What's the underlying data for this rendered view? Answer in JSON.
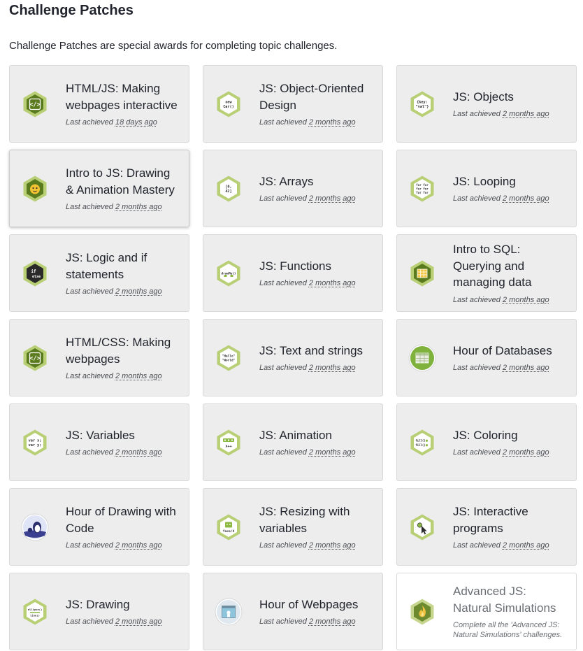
{
  "header": {
    "title": "Challenge Patches",
    "description": "Challenge Patches are special awards for completing topic challenges."
  },
  "colors": {
    "hex_outer": "#b8cf75",
    "hex_inner": "#5a7a1e",
    "card_bg": "#ededed",
    "text": "#21242c"
  },
  "patches": [
    {
      "title": "HTML/JS: Making webpages interactive",
      "achieved_label": "Last achieved",
      "achieved_ago": "18 days ago",
      "icon": "code-brackets-icon"
    },
    {
      "title": "JS: Object-Oriented Design",
      "achieved_label": "Last achieved",
      "achieved_ago": "2 months ago",
      "icon": "new-car-code-icon",
      "glyph_lines": [
        "new",
        "Car()"
      ]
    },
    {
      "title": "JS: Objects",
      "achieved_label": "Last achieved",
      "achieved_ago": "2 months ago",
      "icon": "key-val-object-icon",
      "glyph_lines": [
        "{key:",
        "\"val\"}"
      ]
    },
    {
      "title": "Intro to JS: Drawing & Animation Mastery",
      "achieved_label": "Last achieved",
      "achieved_ago": "2 months ago",
      "icon": "winston-character-icon"
    },
    {
      "title": "JS: Arrays",
      "achieved_label": "Last achieved",
      "achieved_ago": "2 months ago",
      "icon": "array-brackets-icon",
      "glyph_lines": [
        "[0,",
        "42]"
      ]
    },
    {
      "title": "JS: Looping",
      "achieved_label": "Last achieved",
      "achieved_ago": "2 months ago",
      "icon": "for-loop-icon",
      "glyph_lines": [
        "for for",
        "for for",
        "for for"
      ]
    },
    {
      "title": "JS: Logic and if statements",
      "achieved_label": "Last achieved",
      "achieved_ago": "2 months ago",
      "icon": "if-else-icon",
      "glyph_lines": [
        "if",
        "else"
      ]
    },
    {
      "title": "JS: Functions",
      "achieved_label": "Last achieved",
      "achieved_ago": "2 months ago",
      "icon": "function-call-icon",
      "glyph_lines": [
        "drawMe()"
      ]
    },
    {
      "title": "Intro to SQL: Querying and managing data",
      "achieved_label": "Last achieved",
      "achieved_ago": "2 months ago",
      "icon": "database-table-icon"
    },
    {
      "title": "HTML/CSS: Making webpages",
      "achieved_label": "Last achieved",
      "achieved_ago": "2 months ago",
      "icon": "code-brackets-icon"
    },
    {
      "title": "JS: Text and strings",
      "achieved_label": "Last achieved",
      "achieved_ago": "2 months ago",
      "icon": "hello-world-string-icon",
      "glyph_lines": [
        "\"Hello\"",
        "\"World\""
      ]
    },
    {
      "title": "Hour of Databases",
      "achieved_label": "Last achieved",
      "achieved_ago": "2 months ago",
      "icon": "database-circle-icon"
    },
    {
      "title": "JS: Variables",
      "achieved_label": "Last achieved",
      "achieved_ago": "2 months ago",
      "icon": "var-declaration-icon",
      "glyph_lines": [
        "var x;",
        "var y;"
      ]
    },
    {
      "title": "JS: Animation",
      "achieved_label": "Last achieved",
      "achieved_ago": "2 months ago",
      "icon": "animation-frames-icon",
      "glyph_lines": [
        "x++"
      ]
    },
    {
      "title": "JS: Coloring",
      "achieved_label": "Last achieved",
      "achieved_ago": "2 months ago",
      "icon": "fill-color-icon",
      "glyph_lines": [
        "fill()",
        "fill()"
      ]
    },
    {
      "title": "Hour of Drawing with Code",
      "achieved_label": "Last achieved",
      "achieved_ago": "2 months ago",
      "icon": "penguin-circle-icon"
    },
    {
      "title": "JS: Resizing with variables",
      "achieved_label": "Last achieved",
      "achieved_ago": "2 months ago",
      "icon": "resize-face-icon",
      "glyph_lines": [
        "face/4"
      ]
    },
    {
      "title": "JS: Interactive programs",
      "achieved_label": "Last achieved",
      "achieved_ago": "2 months ago",
      "icon": "mouse-cursor-icon"
    },
    {
      "title": "JS: Drawing",
      "achieved_label": "Last achieved",
      "achieved_ago": "2 months ago",
      "icon": "drawing-shapes-icon",
      "glyph_lines": [
        "ellipse()",
        "line()"
      ]
    },
    {
      "title": "Hour of Webpages",
      "achieved_label": "Last achieved",
      "achieved_ago": "2 months ago",
      "icon": "webpage-circle-icon"
    },
    {
      "title": "Advanced JS: Natural Simulations",
      "achieved_label": "",
      "achieved_ago": "",
      "note": "Complete all the 'Advanced JS: Natural Simulations' challenges.",
      "icon": "flame-icon",
      "locked": true
    }
  ]
}
